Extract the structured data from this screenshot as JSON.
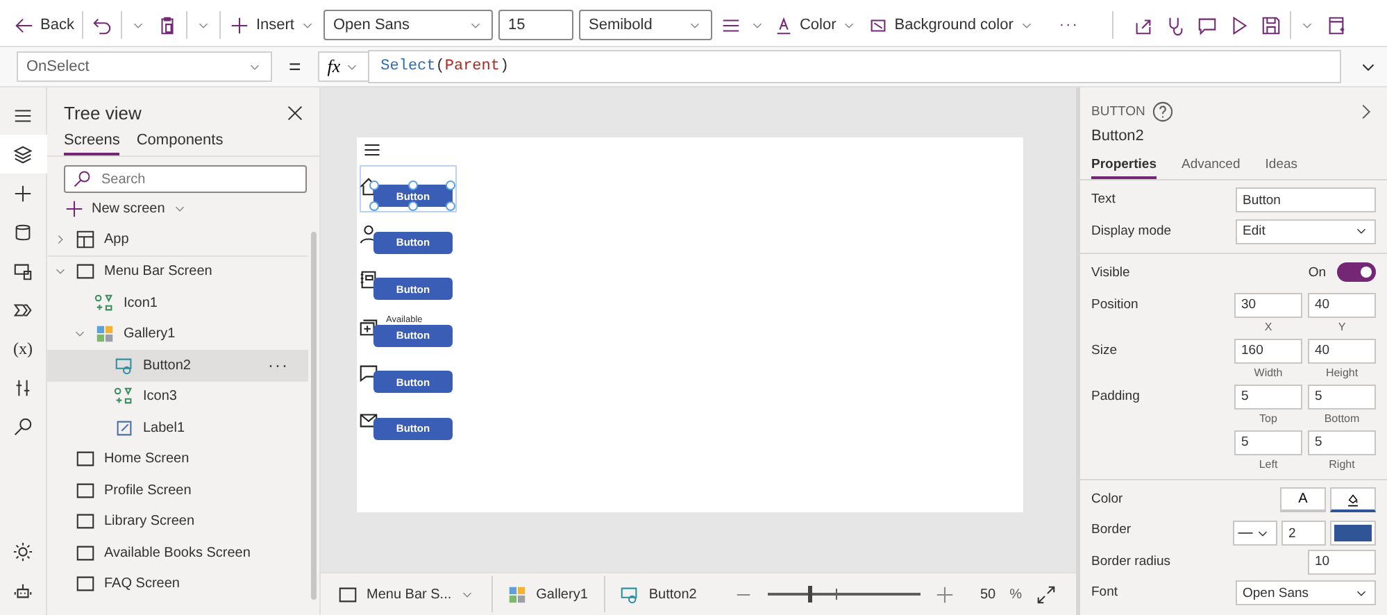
{
  "toolbar": {
    "back": "Back",
    "insert": "Insert",
    "font": "Open Sans",
    "size": "15",
    "weight": "Semibold",
    "fill_buttons": [
      {
        "label": "Color",
        "kind": "text"
      },
      {
        "label": "Background color",
        "kind": "background"
      }
    ],
    "more": "···"
  },
  "formula_bar": {
    "property": "OnSelect",
    "equals": "=",
    "fx": "fx",
    "tokens": [
      {
        "text": "Select",
        "kind": "function"
      },
      {
        "text": "(",
        "kind": "punct"
      },
      {
        "text": "Parent",
        "kind": "keyword"
      },
      {
        "text": ")",
        "kind": "punct"
      }
    ]
  },
  "rail": [
    {
      "kind": "menu",
      "selected": false
    },
    {
      "kind": "layers",
      "selected": true
    },
    {
      "kind": "plus",
      "selected": false
    },
    {
      "kind": "database",
      "selected": false
    },
    {
      "kind": "media",
      "selected": false
    },
    {
      "kind": "flow",
      "selected": false
    },
    {
      "kind": "variables",
      "glyph": "(x)",
      "selected": false
    },
    {
      "kind": "tools",
      "selected": false
    },
    {
      "kind": "search",
      "selected": false
    }
  ],
  "rail_bottom": [
    {
      "kind": "gear",
      "selected": false
    },
    {
      "kind": "robot",
      "selected": false
    }
  ],
  "tree": {
    "title": "Tree view",
    "tabs": [
      {
        "label": "Screens",
        "selected": true
      },
      {
        "label": "Components",
        "selected": false
      }
    ],
    "search": {
      "placeholder": "Search"
    },
    "new_screen": "New screen",
    "item_menu": "···",
    "items": [
      {
        "label": "App",
        "kind": "app",
        "expanded": false,
        "selected": false
      },
      {
        "label": "Menu Bar Screen",
        "kind": "screen",
        "expanded": true,
        "selected": false,
        "children": [
          {
            "label": "Icon1",
            "kind": "icon",
            "selected": false
          },
          {
            "label": "Gallery1",
            "kind": "gallery",
            "expanded": true,
            "selected": false,
            "children": [
              {
                "label": "Button2",
                "kind": "button",
                "selected": true
              },
              {
                "label": "Icon3",
                "kind": "icon",
                "selected": false
              },
              {
                "label": "Label1",
                "kind": "label",
                "selected": false
              }
            ]
          }
        ]
      },
      {
        "label": "Home Screen",
        "kind": "screen",
        "selected": false
      },
      {
        "label": "Profile Screen",
        "kind": "screen",
        "selected": false
      },
      {
        "label": "Library Screen",
        "kind": "screen",
        "selected": false
      },
      {
        "label": "Available Books Screen",
        "kind": "screen",
        "selected": false
      },
      {
        "label": "FAQ Screen",
        "kind": "screen",
        "selected": false
      }
    ]
  },
  "canvas": {
    "rows": [
      {
        "kind": "home",
        "button": "Button",
        "selected": true
      },
      {
        "kind": "person",
        "button": "Button",
        "selected": false
      },
      {
        "kind": "notebook",
        "button": "Button",
        "selected": false
      },
      {
        "kind": "plusbox",
        "label": "Available",
        "button": "Button",
        "selected": false
      },
      {
        "kind": "chat",
        "button": "Button",
        "selected": false
      },
      {
        "kind": "mail",
        "button": "Button",
        "selected": false
      }
    ]
  },
  "status_bar": {
    "screen": "Menu Bar S...",
    "gallery": "Gallery1",
    "control": "Button2",
    "zoom": {
      "level": 0.26,
      "value": "50",
      "unit": "%"
    }
  },
  "panel": {
    "type": "BUTTON",
    "name": "Button2",
    "tabs": [
      {
        "label": "Properties",
        "selected": true
      },
      {
        "label": "Advanced",
        "selected": false
      },
      {
        "label": "Ideas",
        "selected": false
      }
    ],
    "sections": [
      [
        {
          "kind": "text",
          "label": "Text",
          "value": "Button"
        },
        {
          "kind": "dropdown",
          "label": "Display mode",
          "value": "Edit"
        }
      ],
      [
        {
          "kind": "toggle",
          "label": "Visible",
          "state_text": "On",
          "on": true
        },
        {
          "kind": "fields",
          "label": "Position",
          "fields": [
            {
              "value": "30",
              "caption": "X"
            },
            {
              "value": "40",
              "caption": "Y"
            }
          ]
        },
        {
          "kind": "fields",
          "label": "Size",
          "fields": [
            {
              "value": "160",
              "caption": "Width"
            },
            {
              "value": "40",
              "caption": "Height"
            }
          ]
        },
        {
          "kind": "fields",
          "label": "Padding",
          "fields": [
            {
              "value": "5",
              "caption": "Top"
            },
            {
              "value": "5",
              "caption": "Bottom"
            },
            {
              "value": "5",
              "caption": "Left"
            },
            {
              "value": "5",
              "caption": "Right"
            }
          ]
        }
      ],
      [
        {
          "kind": "color",
          "label": "Color",
          "glyph": "A"
        },
        {
          "kind": "border",
          "label": "Border",
          "value": "2"
        },
        {
          "kind": "number",
          "label": "Border radius",
          "value": "10"
        },
        {
          "kind": "dropdown",
          "label": "Font",
          "value": "Open Sans"
        }
      ]
    ]
  }
}
